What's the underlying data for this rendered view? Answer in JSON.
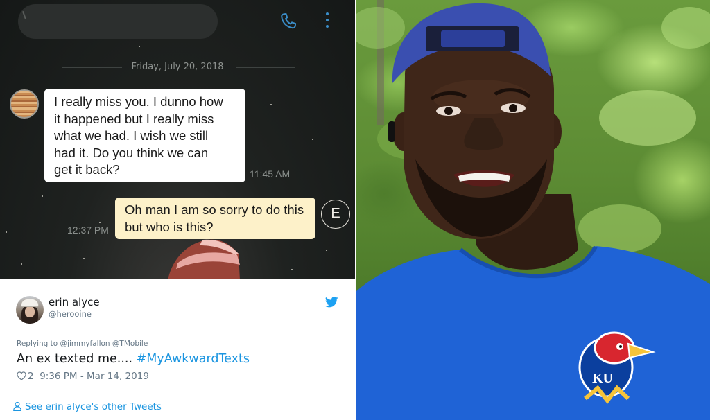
{
  "chat": {
    "date": "Friday, July 20, 2018",
    "incoming": {
      "lines": [
        "I really miss you. I dunno how",
        "it happened but I really miss",
        "what we had. I wish we still",
        "had it. Do you think we can",
        "get it back?"
      ],
      "time": "11:45 AM"
    },
    "outgoing": {
      "lines": [
        "Oh man I am so sorry to do this",
        "but who is this?"
      ],
      "time": "12:37 PM",
      "avatar_letter": "E"
    },
    "icons": {
      "call": "phone-icon",
      "menu": "more-vertical-icon"
    }
  },
  "tweet": {
    "name": "erin alyce",
    "handle": "@herooine",
    "replying_to": "Replying to @jimmyfallon @TMobile",
    "text": "An ex texted me.... ",
    "hashtag": "#MyAwkwardTexts",
    "likes": "2",
    "timestamp": "9:36 PM - Mar 14, 2019",
    "more_link": "See erin alyce's other Tweets",
    "icons": {
      "brand": "twitter-bird-icon",
      "like": "heart-icon",
      "profile": "person-icon"
    },
    "colors": {
      "link": "#1b95e0",
      "secondary": "#657786"
    }
  },
  "photo": {
    "shirt_logo_text": "KU",
    "colors": {
      "shirt": "#1f63d6",
      "foliage": "#6a9b3d",
      "cap": "#3a4fb0"
    }
  }
}
